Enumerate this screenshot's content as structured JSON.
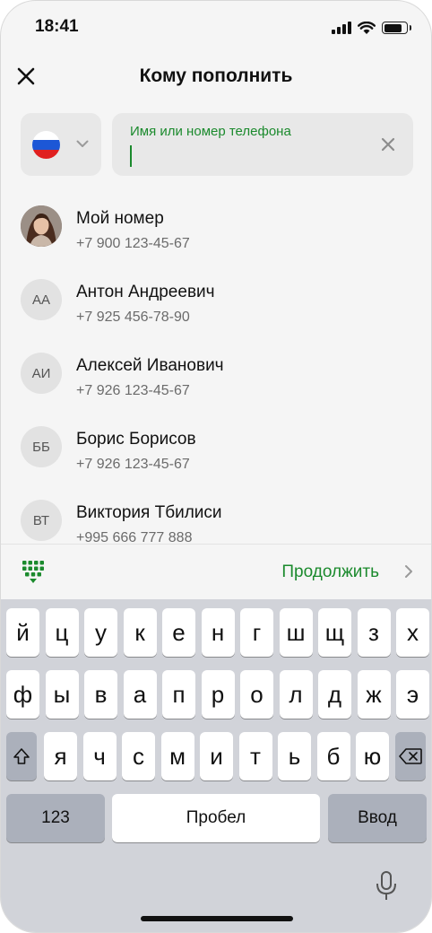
{
  "status": {
    "time": "18:41",
    "battery_level": 0.9
  },
  "header": {
    "title": "Кому пополнить",
    "close_icon": "close-icon"
  },
  "country": {
    "flag_colors": [
      "#ffffff",
      "#1c57d6",
      "#e02020"
    ],
    "icon": "chevron-down-icon"
  },
  "search": {
    "label": "Имя или номер телефона",
    "value": "",
    "clear_icon": "clear-icon"
  },
  "contacts": [
    {
      "initials": "",
      "name": "Мой номер",
      "phone": "+7 900 123-45-67",
      "has_photo": true
    },
    {
      "initials": "АА",
      "name": "Антон Андреевич",
      "phone": "+7 925 456-78-90"
    },
    {
      "initials": "АИ",
      "name": "Алексей Иванович",
      "phone": "+7 926 123-45-67"
    },
    {
      "initials": "ББ",
      "name": "Борис Борисов",
      "phone": "+7 926 123-45-67"
    },
    {
      "initials": "ВТ",
      "name": "Виктория Тбилиси",
      "phone": "+995 666 777 888"
    }
  ],
  "action_bar": {
    "continue_label": "Продолжить",
    "keypad_icon": "dial-keypad-icon"
  },
  "keyboard": {
    "row1": [
      "й",
      "ц",
      "у",
      "к",
      "е",
      "н",
      "г",
      "ш",
      "щ",
      "з",
      "х"
    ],
    "row2": [
      "ф",
      "ы",
      "в",
      "а",
      "п",
      "р",
      "о",
      "л",
      "д",
      "ж",
      "э"
    ],
    "row3": [
      "я",
      "ч",
      "с",
      "м",
      "и",
      "т",
      "ь",
      "б",
      "ю"
    ],
    "numbers_label": "123",
    "space_label": "Пробел",
    "enter_label": "Ввод"
  },
  "colors": {
    "accent": "#1b8a2d",
    "background": "#f5f5f5",
    "keyboard": "#d1d3d9"
  }
}
